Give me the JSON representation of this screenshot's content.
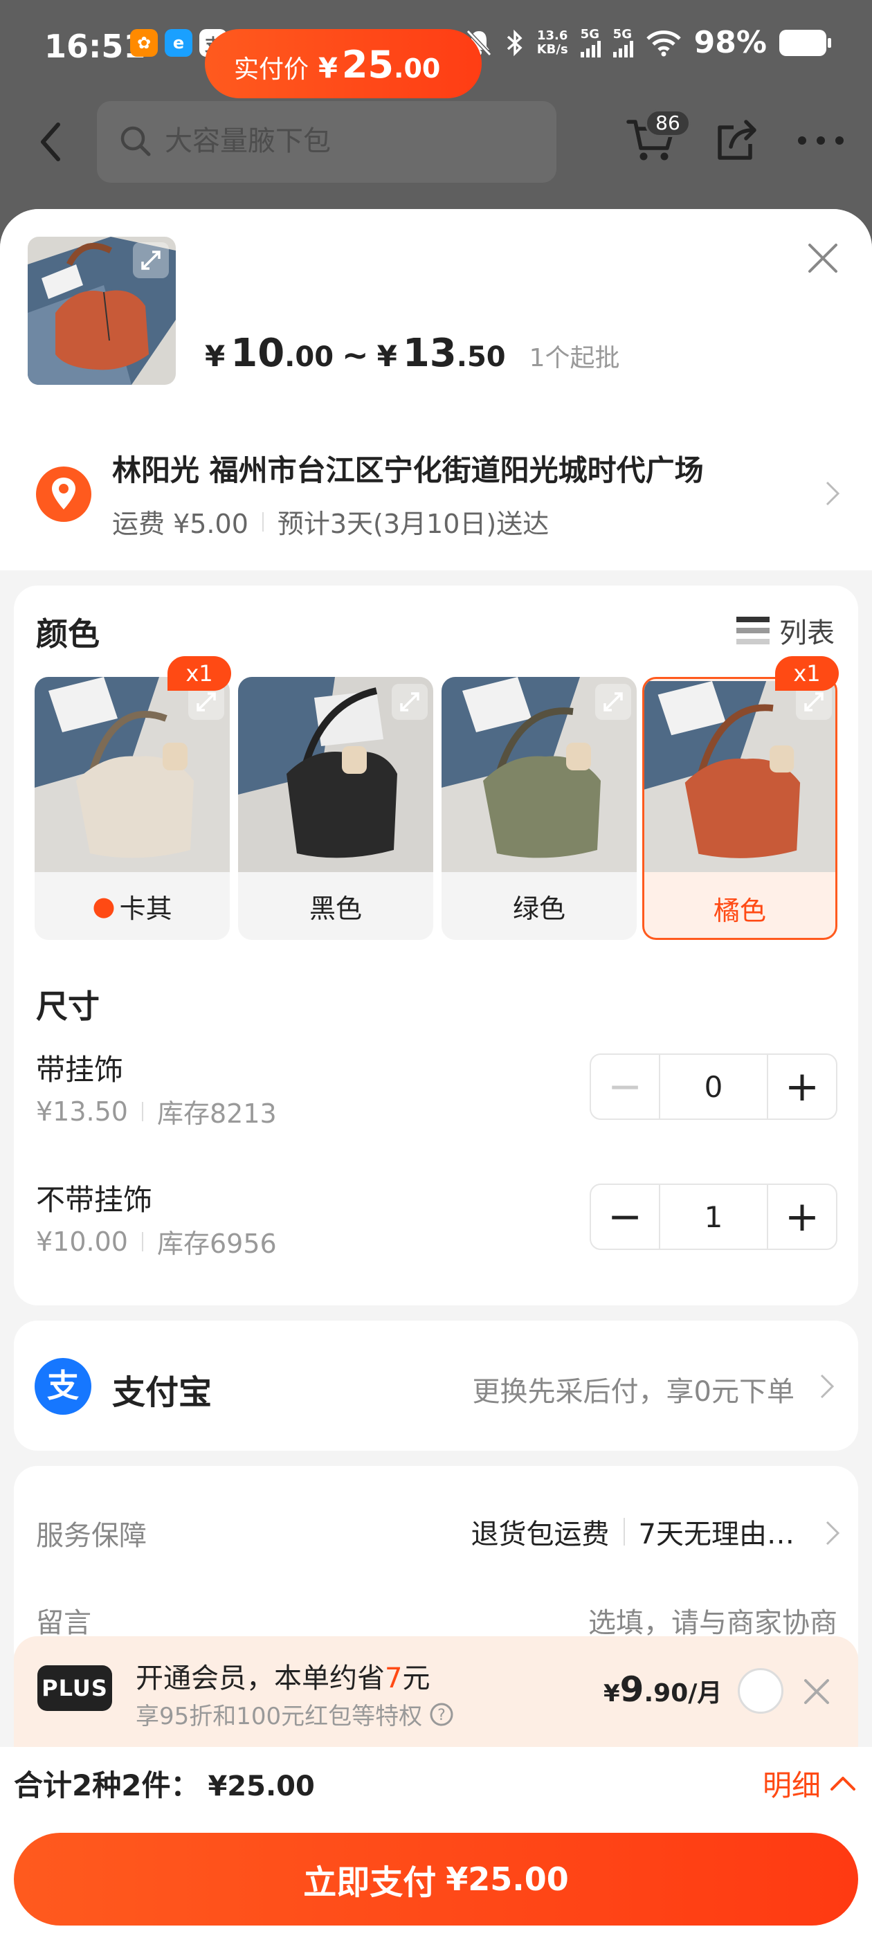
{
  "status_bar": {
    "time": "16:51",
    "net_speed_value": "13.6",
    "net_speed_unit": "KB/s",
    "sim1": "5G",
    "sim2": "5G",
    "battery": "98%",
    "app_icons": [
      "taobao-shop-icon",
      "alipay-app-icon",
      "zhi-icon",
      "tao-icon",
      "cat-app-icon"
    ]
  },
  "nav": {
    "search_placeholder": "大容量腋下包",
    "cart_count": "86"
  },
  "product": {
    "pay_label": "实付价",
    "pay_currency": "¥",
    "pay_int": "25",
    "pay_dec": ".00",
    "range_currency": "¥",
    "range_low_int": "10",
    "range_low_dec": ".00",
    "range_sep": "~",
    "range_high_int": "13",
    "range_high_dec": ".50",
    "moq": "1个起批"
  },
  "address": {
    "name_line": "林阳光 福州市台江区宁化街道阳光城时代广场",
    "shipping": "运费 ¥5.00",
    "eta": "预计3天(3月10日)送达"
  },
  "color_section": {
    "title": "颜色",
    "list_toggle": "列表",
    "options": [
      {
        "label": "卡其",
        "badge": "x1",
        "hot": true,
        "selected": false
      },
      {
        "label": "黑色",
        "badge": "",
        "selected": false
      },
      {
        "label": "绿色",
        "badge": "",
        "selected": false
      },
      {
        "label": "橘色",
        "badge": "x1",
        "selected": true
      }
    ]
  },
  "size_section": {
    "title": "尺寸",
    "items": [
      {
        "name": "带挂饰",
        "price": "¥13.50",
        "stock": "库存8213",
        "qty": "0",
        "minus": "−",
        "plus": "+"
      },
      {
        "name": "不带挂饰",
        "price": "¥10.00",
        "stock": "库存6956",
        "qty": "1",
        "minus": "−",
        "plus": "+"
      }
    ]
  },
  "payment": {
    "method": "支付宝",
    "hint": "更换先采后付，享0元下单"
  },
  "service": {
    "label": "服务保障",
    "values": [
      "退货包运费",
      "7天无理由…"
    ],
    "message_label": "留言",
    "message_placeholder": "选填，请与商家协商"
  },
  "plus": {
    "badge": "PLUS",
    "title_pre": "开通会员，本单约省",
    "title_num": "7",
    "title_post": "元",
    "subtitle": "享95折和100元红包等特权",
    "price_currency": "¥",
    "price_int": "9",
    "price_dec": ".90/月"
  },
  "footer": {
    "total_label": "合计2种2件：",
    "total_amount": "¥25.00",
    "detail_label": "明细",
    "pay_button": "立即支付",
    "pay_amount": "¥25.00"
  },
  "colors": {
    "accent": "#ff4a14",
    "alipay_blue": "#1677ff"
  }
}
